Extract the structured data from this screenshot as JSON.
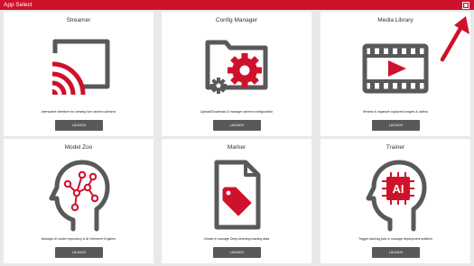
{
  "app": {
    "title": "App Select"
  },
  "colors": {
    "accent": "#d0112b",
    "icon_gray": "#595959",
    "button_gray": "#595959"
  },
  "cards": [
    {
      "name": "Streamer",
      "icon": "cast-icon",
      "description": "Interactive interface for viewing live camera streams",
      "button": "LAUNCH"
    },
    {
      "name": "Config Manager",
      "icon": "folder-gear-icon",
      "description": "Upload/Download & manage camera configuration",
      "button": "LAUNCH"
    },
    {
      "name": "Media Library",
      "icon": "film-play-icon",
      "description": "Review & organize captured images & videos",
      "button": "LAUNCH"
    },
    {
      "name": "Model Zoo",
      "icon": "ai-head-network-icon",
      "description": "Manage AI model repository & AI Inference Engines",
      "button": "LAUNCH"
    },
    {
      "name": "Marker",
      "icon": "document-tag-icon",
      "description": "Create & manage Deep-learning training data",
      "button": "LAUNCH"
    },
    {
      "name": "Trainer",
      "icon": "ai-chip-head-icon",
      "description": "Trigger training jobs & manage deployment artifacts",
      "button": "LAUNCH"
    }
  ]
}
